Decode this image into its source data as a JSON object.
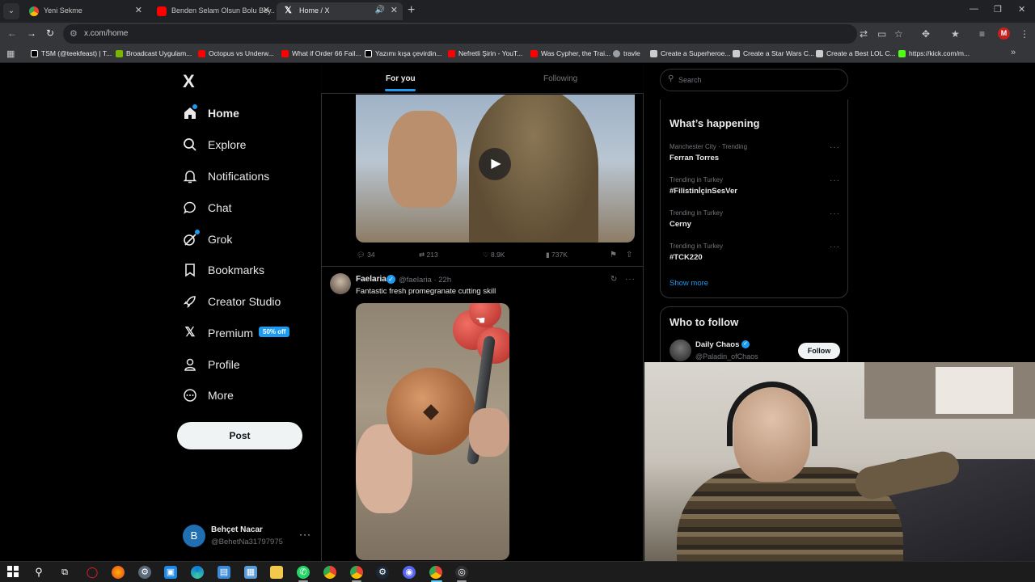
{
  "browser": {
    "tabs": [
      {
        "title": "Yeni Sekme",
        "close": "✕"
      },
      {
        "title": "Benden Selam Olsun Bolu Bey...",
        "close": "✕"
      },
      {
        "title": "Home / X",
        "close": "✕"
      }
    ],
    "new_tab": "+",
    "window_controls": {
      "minimize": "—",
      "restore": "❐",
      "close": "✕"
    },
    "nav": {
      "back": "←",
      "forward": "→",
      "reload": "↻"
    },
    "url": "x.com/home",
    "profile_initial": "M"
  },
  "bookmarks": [
    {
      "label": "TSM (@teekfeast) | T...",
      "color": "#ffffff"
    },
    {
      "label": "Broadcast Uygulam...",
      "color": "#76b900"
    },
    {
      "label": "Octopus vs Underw...",
      "color": "#ff0000"
    },
    {
      "label": "What if Order 66 Fail...",
      "color": "#ff0000"
    },
    {
      "label": "Yazımı kışa çevirdin...",
      "color": "#ffffff"
    },
    {
      "label": "Nefretli Şirin - YouT...",
      "color": "#ff0000"
    },
    {
      "label": "Was Cypher, the Trai...",
      "color": "#ff0000"
    },
    {
      "label": "travle",
      "color": "#9aa0a6"
    },
    {
      "label": "Create a Superheroe...",
      "color": "#cccccc"
    },
    {
      "label": "Create a Star Wars C...",
      "color": "#cccccc"
    },
    {
      "label": "Create a Best LOL C...",
      "color": "#cccccc"
    },
    {
      "label": "https://kick.com/m...",
      "color": "#53fc18"
    }
  ],
  "sidebar": {
    "logo": "X",
    "items": [
      {
        "label": "Home",
        "icon": "home-icon"
      },
      {
        "label": "Explore",
        "icon": "search-icon"
      },
      {
        "label": "Notifications",
        "icon": "bell-icon"
      },
      {
        "label": "Chat",
        "icon": "chat-icon"
      },
      {
        "label": "Grok",
        "icon": "grok-icon"
      },
      {
        "label": "Bookmarks",
        "icon": "bookmark-icon"
      },
      {
        "label": "Creator Studio",
        "icon": "rocket-icon"
      },
      {
        "label": "Premium",
        "icon": "x-icon"
      },
      {
        "label": "Profile",
        "icon": "person-icon"
      },
      {
        "label": "More",
        "icon": "more-circle-icon"
      }
    ],
    "premium_badge": "50% off",
    "post_button": "Post",
    "account": {
      "initial": "B",
      "name": "Behçet Nacar",
      "handle": "@BehetNa31797975"
    }
  },
  "feed": {
    "tabs": {
      "for_you": "For you",
      "following": "Following"
    },
    "first_post_stats": {
      "replies": "34",
      "reposts": "213",
      "likes": "8.9K",
      "views": "737K"
    },
    "tweet": {
      "name": "Faelaria",
      "handle": "@faelaria",
      "time": "22h",
      "text": "Fantastic fresh promegranate cutting skill"
    }
  },
  "right": {
    "search_placeholder": "Search",
    "happening": {
      "title": "What’s happening",
      "trends": [
        {
          "category": "Manchester City · Trending",
          "name": "Ferran Torres"
        },
        {
          "category": "Trending in Turkey",
          "name": "#FilistinİçinSesVer"
        },
        {
          "category": "Trending in Turkey",
          "name": "Cerny"
        },
        {
          "category": "Trending in Turkey",
          "name": "#TCK220"
        }
      ],
      "show_more": "Show more"
    },
    "who_to_follow": {
      "title": "Who to follow",
      "name": "Daily Chaos",
      "handle": "@Paladin_ofChaos",
      "follow_label": "Follow"
    }
  },
  "colors": {
    "accent": "#1d9bf0",
    "background": "#000000",
    "taskbar": "#1c1c1c"
  }
}
